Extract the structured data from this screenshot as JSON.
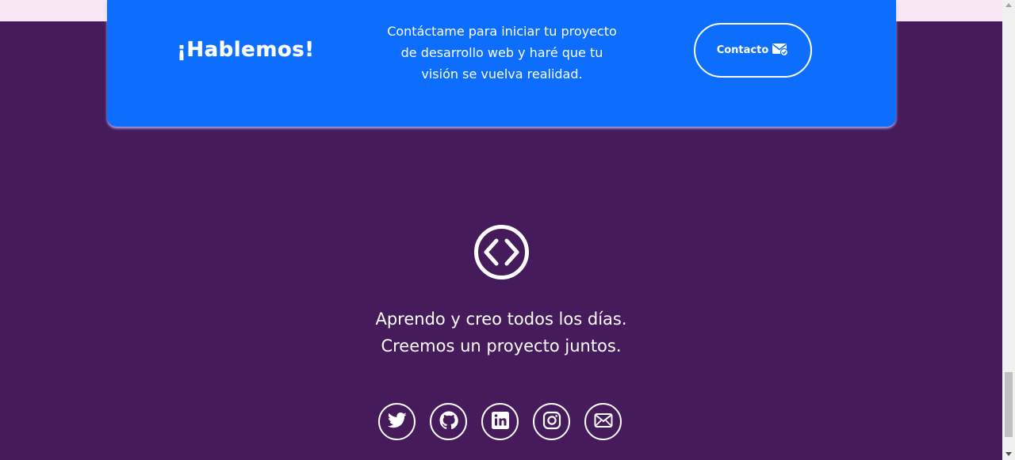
{
  "cta": {
    "title": "¡Hablemos!",
    "text_lines": [
      "Contáctame para iniciar tu proyecto",
      "de desarrollo web y haré que tu",
      "visión se vuelva realidad."
    ],
    "button_label": "Contacto",
    "button_icon": "envelope-check-icon"
  },
  "footer": {
    "logo_icon": "code-brackets-icon",
    "tagline_lines": [
      "Aprendo y creo todos los días.",
      "Creemos un proyecto juntos."
    ],
    "social": [
      "twitter-icon",
      "github-icon",
      "linkedin-icon",
      "instagram-icon",
      "mail-icon"
    ]
  },
  "colors": {
    "background": "#461b5c",
    "card": "#0d6efd",
    "top_strip": "#f7e7f5",
    "foreground": "#ffffff"
  }
}
